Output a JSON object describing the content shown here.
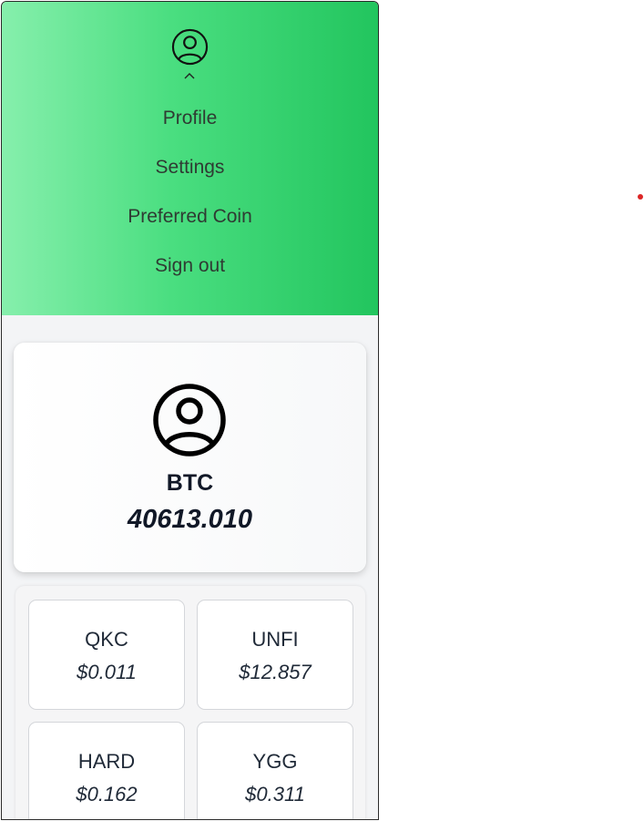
{
  "header": {
    "avatar_icon": "user-circle-icon",
    "caret_icon": "chevron-up-icon",
    "menu": [
      {
        "label": "Profile"
      },
      {
        "label": "Settings"
      },
      {
        "label": "Preferred Coin"
      },
      {
        "label": "Sign out"
      }
    ],
    "gradient_start": "#86efac",
    "gradient_end": "#22c55e"
  },
  "featured": {
    "avatar_icon": "user-circle-icon",
    "symbol": "BTC",
    "value": "40613.010"
  },
  "coins": [
    {
      "symbol": "QKC",
      "price": "$0.011"
    },
    {
      "symbol": "UNFI",
      "price": "$12.857"
    },
    {
      "symbol": "HARD",
      "price": "$0.162"
    },
    {
      "symbol": "YGG",
      "price": "$0.311"
    }
  ],
  "indicator_color": "#dc2626"
}
